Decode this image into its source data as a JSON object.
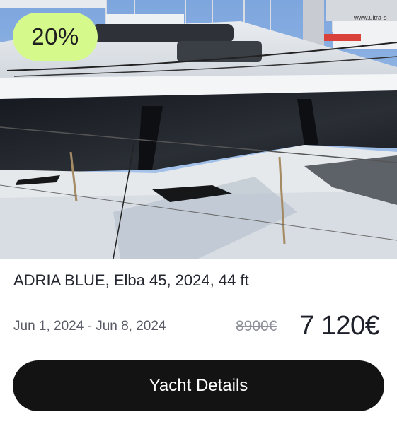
{
  "listing": {
    "discount_badge": "20%",
    "title": "ADRIA BLUE, Elba 45, 2024, 44 ft",
    "date_range": "Jun 1, 2024 - Jun 8, 2024",
    "original_price": "8900€",
    "price": "7 120€",
    "details_button_label": "Yacht Details",
    "photo_sign_text": "www.ultra-s"
  },
  "colors": {
    "badge_bg": "#d6f98c",
    "button_bg": "#131313",
    "button_text": "#ffffff"
  }
}
